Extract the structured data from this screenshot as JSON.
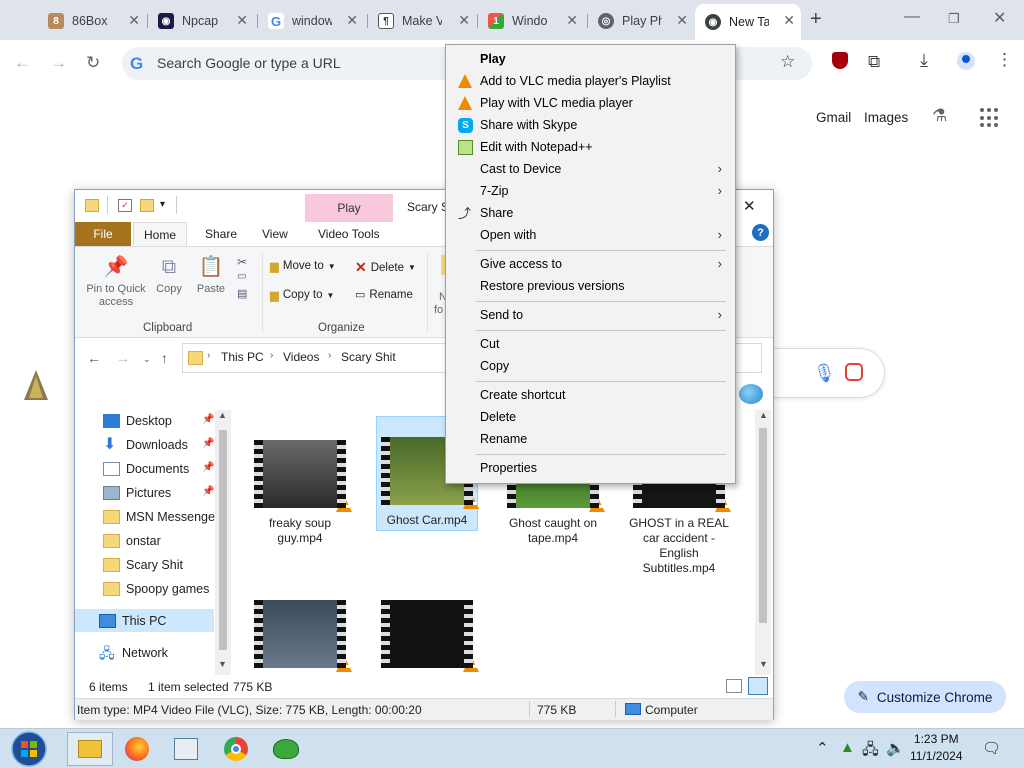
{
  "browser": {
    "tabs": [
      {
        "label": "86Box",
        "icon_name": "86box-icon"
      },
      {
        "label": "Npcap",
        "icon_name": "npcap-eye-icon"
      },
      {
        "label": "window",
        "icon_name": "google-icon"
      },
      {
        "label": "Make V",
        "icon_name": "document-icon"
      },
      {
        "label": "Windo",
        "icon_name": "windows-logo-icon"
      },
      {
        "label": "Play Ph",
        "icon_name": "globe-icon"
      },
      {
        "label": "New Ta",
        "icon_name": "chrome-icon"
      }
    ],
    "new_tab_symbol": "+",
    "omnibox_placeholder": "Search Google or type a URL",
    "google_links": {
      "gmail": "Gmail",
      "images": "Images"
    },
    "customize_label": "Customize Chrome",
    "colors": {
      "tabstrip": "#dfe4ec",
      "omnibox": "#eef1f6",
      "customize": "#d3e3fd"
    }
  },
  "explorer": {
    "play_tab": "Play",
    "title": "Scary S",
    "ribbon_tabs": [
      "File",
      "Home",
      "Share",
      "View",
      "Video Tools"
    ],
    "clipboard": {
      "pin": "Pin to Quick access",
      "copy": "Copy",
      "paste": "Paste",
      "group": "Clipboard"
    },
    "organize": {
      "move_to": "Move to",
      "copy_to": "Copy to",
      "delete": "Delete",
      "rename": "Rename",
      "new_partial_1": "N",
      "new_partial_2": "fo",
      "group": "Organize"
    },
    "breadcrumb": [
      "This PC",
      "Videos",
      "Scary Shit"
    ],
    "nav_items": [
      {
        "label": "Desktop",
        "pinned": true
      },
      {
        "label": "Downloads",
        "pinned": true
      },
      {
        "label": "Documents",
        "pinned": true
      },
      {
        "label": "Pictures",
        "pinned": true
      },
      {
        "label": "MSN Messenger",
        "pinned": false
      },
      {
        "label": "onstar",
        "pinned": false
      },
      {
        "label": "Scary Shit",
        "pinned": false
      },
      {
        "label": "Spoopy games",
        "pinned": false
      }
    ],
    "this_pc": "This PC",
    "network": "Network",
    "files": [
      {
        "name": "freaky soup guy.mp4",
        "selected": false
      },
      {
        "name": "Ghost Car.mp4",
        "selected": true
      },
      {
        "name": "Ghost caught on tape.mp4",
        "selected": false
      },
      {
        "name": "GHOST in a REAL car accident - English Subtitles.mp4",
        "selected": false
      },
      {
        "name": "",
        "selected": false
      },
      {
        "name": "",
        "selected": false
      }
    ],
    "status": {
      "count": "6 items",
      "selected": "1 item selected",
      "size": "775 KB"
    },
    "details": {
      "info": "Item type: MP4 Video File (VLC), Size: 775 KB, Length: 00:00:20",
      "size": "775 KB",
      "location": "Computer"
    }
  },
  "context_menu": {
    "items": [
      {
        "label": "Play",
        "bold": true
      },
      {
        "label": "Add to VLC media player's Playlist",
        "icon": "vlc-icon"
      },
      {
        "label": "Play with VLC media player",
        "icon": "vlc-icon"
      },
      {
        "label": "Share with Skype",
        "icon": "skype-icon"
      },
      {
        "label": "Edit with Notepad++",
        "icon": "notepad-plus-plus-icon"
      },
      {
        "label": "Cast to Device",
        "submenu": true
      },
      {
        "label": "7-Zip",
        "submenu": true
      },
      {
        "label": "Share",
        "icon": "share-icon"
      },
      {
        "label": "Open with",
        "submenu": true
      },
      {
        "label": "Give access to",
        "submenu": true
      },
      {
        "label": "Restore previous versions"
      },
      {
        "label": "Send to",
        "submenu": true
      },
      {
        "label": "Cut"
      },
      {
        "label": "Copy"
      },
      {
        "label": "Create shortcut"
      },
      {
        "label": "Delete"
      },
      {
        "label": "Rename"
      },
      {
        "label": "Properties"
      }
    ],
    "submenu_arrow": "›"
  },
  "taskbar": {
    "apps": [
      "file-explorer-icon",
      "firefox-icon",
      "control-panel-icon",
      "chrome-icon",
      "frog-app-icon"
    ],
    "time": "1:23 PM",
    "date": "11/1/2024",
    "colors": {
      "bar": "#cfe0ef"
    }
  }
}
